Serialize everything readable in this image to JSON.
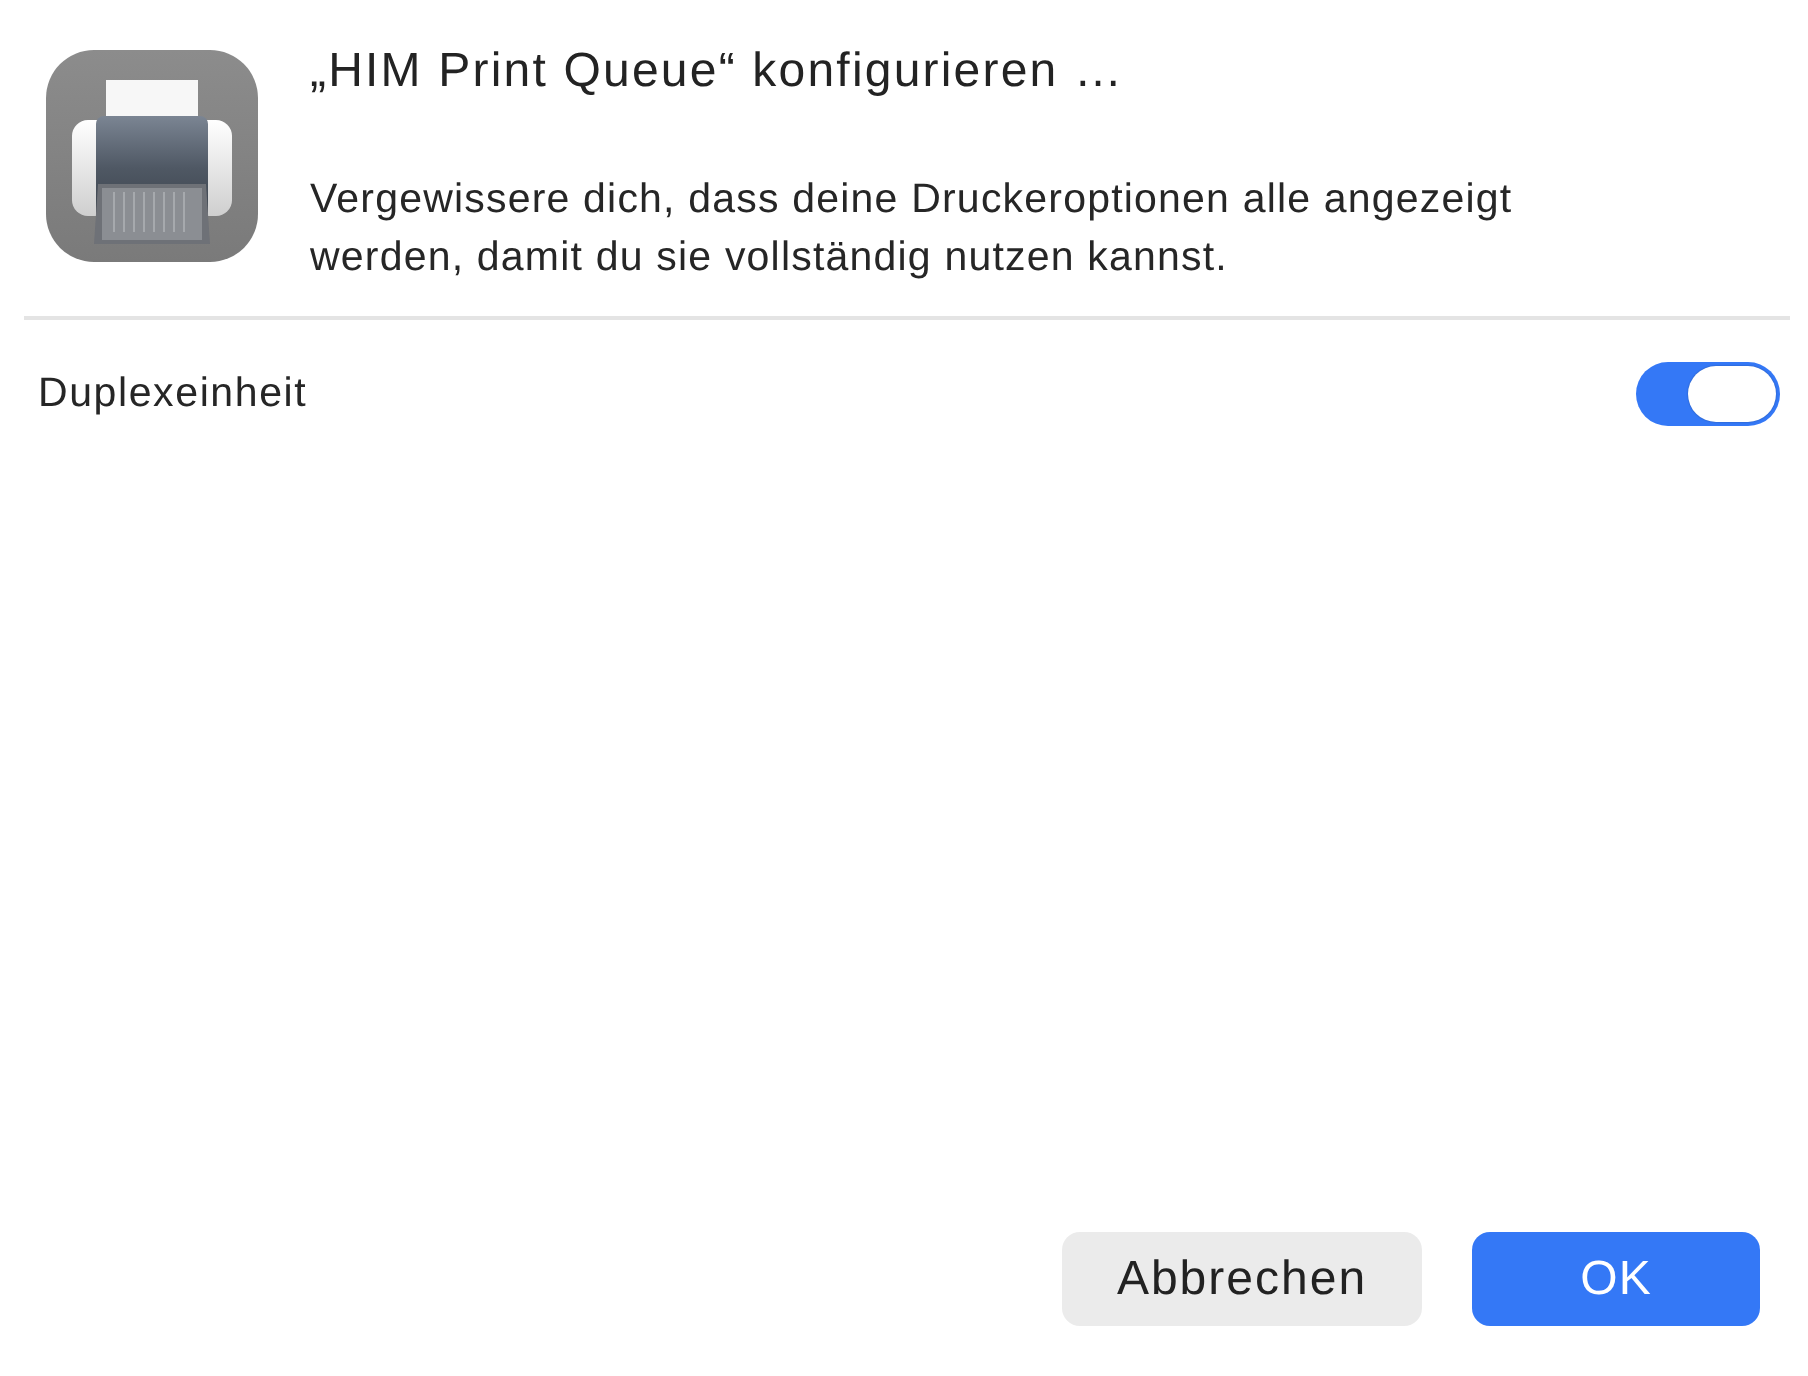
{
  "dialog": {
    "title": "„HIM Print Queue“ konfigurieren …",
    "message": "Vergewissere dich, dass deine Druckeroptionen alle angezeigt werden, damit du sie vollständig nutzen kannst."
  },
  "options": [
    {
      "label": "Duplexeinheit",
      "kind": "switch",
      "on": true
    }
  ],
  "buttons": [
    {
      "label": "Abbrechen",
      "kind": "secondary"
    },
    {
      "label": "OK",
      "kind": "primary"
    }
  ]
}
